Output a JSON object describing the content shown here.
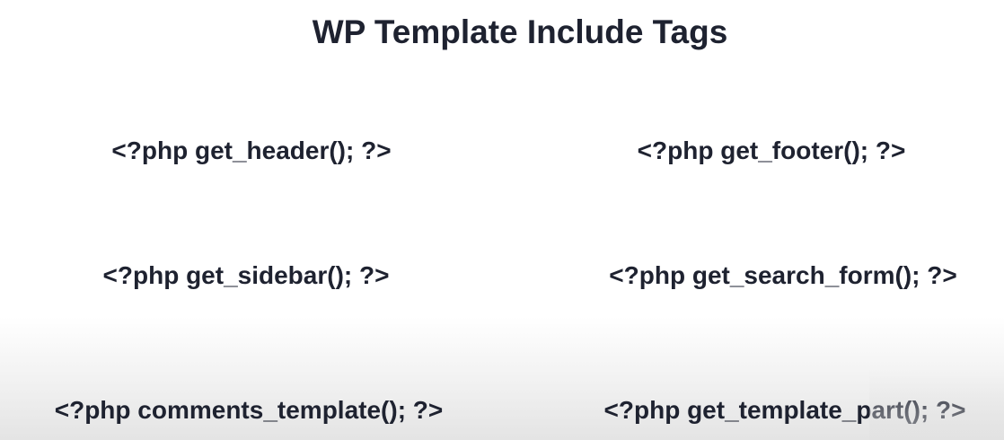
{
  "slide": {
    "title": "WP Template Include Tags",
    "tags": [
      "<?php get_header(); ?>",
      "<?php get_footer(); ?>",
      "<?php get_sidebar(); ?>",
      "<?php get_search_form(); ?>",
      "<?php comments_template(); ?>",
      "<?php get_template_part(); ?>"
    ]
  }
}
